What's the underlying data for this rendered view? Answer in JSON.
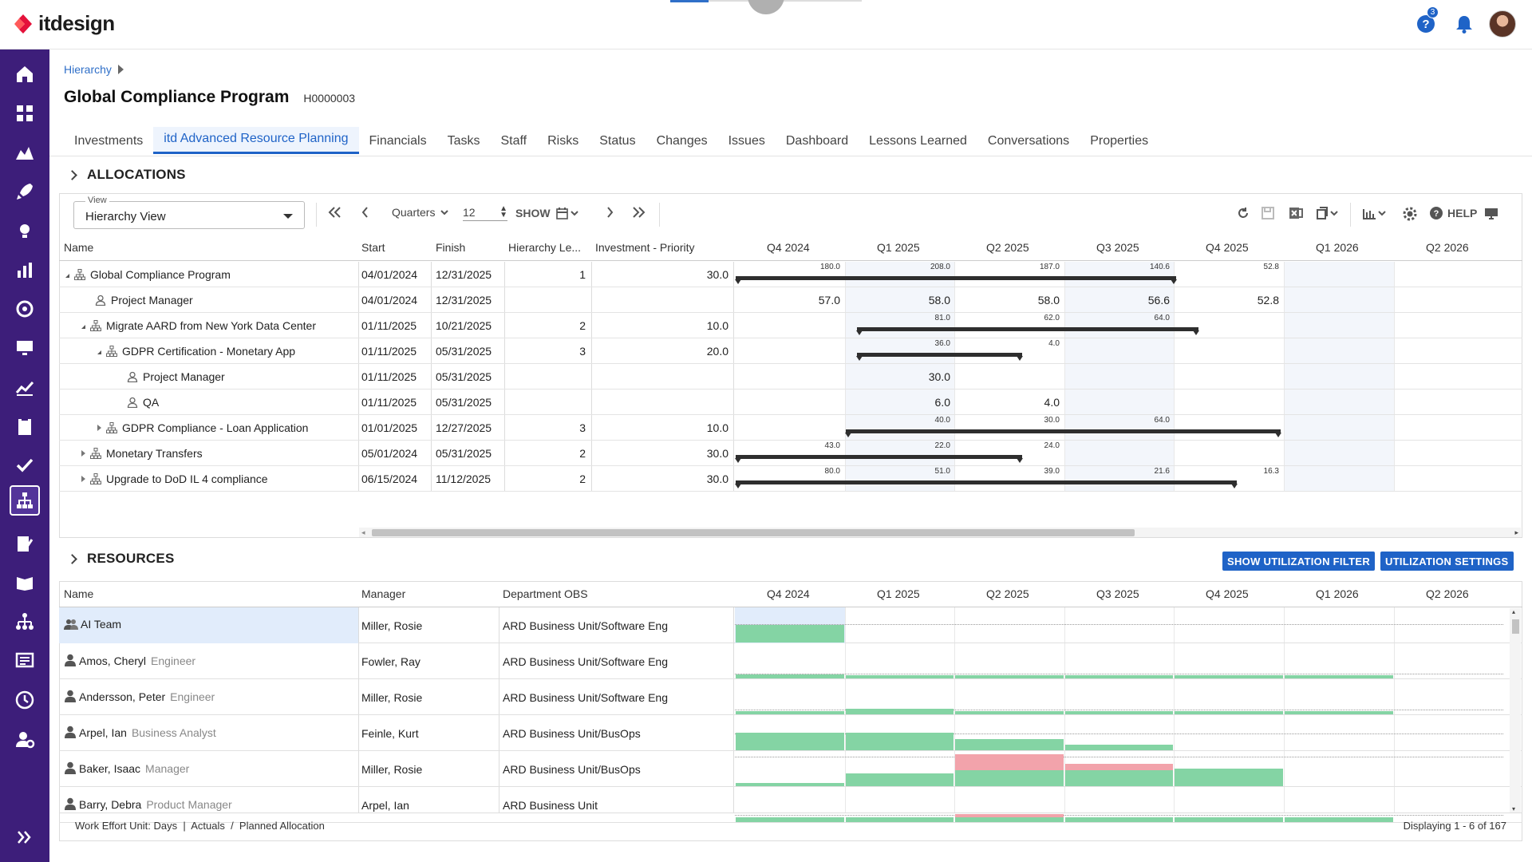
{
  "app": {
    "name": "itdesign",
    "help_badge": "3"
  },
  "breadcrumb": {
    "label": "Hierarchy"
  },
  "page": {
    "title": "Global Compliance Program",
    "code": "H0000003"
  },
  "tabs": [
    "Investments",
    "itd Advanced Resource Planning",
    "Financials",
    "Tasks",
    "Staff",
    "Risks",
    "Status",
    "Changes",
    "Issues",
    "Dashboard",
    "Lessons Learned",
    "Conversations",
    "Properties"
  ],
  "active_tab": "itd Advanced Resource Planning",
  "nav_icons": [
    "home-icon",
    "dashboard-icon",
    "portfolio-icon",
    "rocket-icon",
    "ideas-icon",
    "reports-icon",
    "goals-icon",
    "monitor-icon",
    "trend-icon",
    "clipboard-icon",
    "check-icon",
    "hierarchy-icon",
    "timesheet-icon",
    "book-icon",
    "org-chart-icon",
    "list-icon",
    "clock-icon",
    "admin-icon",
    "expand-icon"
  ],
  "allocations": {
    "title": "ALLOCATIONS",
    "view_label": "View",
    "view_value": "Hierarchy View",
    "period": "Quarters",
    "count": "12",
    "show_label": "SHOW",
    "help_label": "HELP",
    "columns": {
      "name": "Name",
      "start": "Start",
      "finish": "Finish",
      "level": "Hierarchy Le...",
      "priority": "Investment - Priority"
    },
    "quarters": [
      "Q4 2024",
      "Q1 2025",
      "Q2 2025",
      "Q3 2025",
      "Q4 2025",
      "Q1 2026",
      "Q2 2026"
    ],
    "rows": [
      {
        "name": "Global Compliance Program",
        "type": "hier",
        "indent": 0,
        "tree": "open",
        "start": "04/01/2024",
        "finish": "12/31/2025",
        "level": "1",
        "priority": "30.0",
        "small": [
          "180.0",
          "208.0",
          "187.0",
          "140.6",
          "52.8"
        ],
        "big": []
      },
      {
        "name": "Project Manager",
        "type": "role",
        "indent": 1,
        "tree": "",
        "start": "04/01/2024",
        "finish": "12/31/2025",
        "level": "",
        "priority": "",
        "small": [],
        "big": [
          "57.0",
          "58.0",
          "58.0",
          "56.6",
          "52.8"
        ]
      },
      {
        "name": "Migrate AARD from New York Data Center",
        "type": "hier",
        "indent": 1,
        "tree": "open",
        "start": "01/11/2025",
        "finish": "10/21/2025",
        "level": "2",
        "priority": "10.0",
        "small": [
          "",
          "81.0",
          "62.0",
          "64.0",
          ""
        ],
        "big": []
      },
      {
        "name": "GDPR Certification - Monetary App",
        "type": "hier",
        "indent": 2,
        "tree": "open",
        "start": "01/11/2025",
        "finish": "05/31/2025",
        "level": "3",
        "priority": "20.0",
        "small": [
          "",
          "36.0",
          "4.0",
          "",
          ""
        ],
        "big": []
      },
      {
        "name": "Project Manager",
        "type": "role",
        "indent": 3,
        "tree": "",
        "start": "01/11/2025",
        "finish": "05/31/2025",
        "level": "",
        "priority": "",
        "small": [],
        "big": [
          "",
          "30.0",
          "",
          "",
          ""
        ]
      },
      {
        "name": "QA",
        "type": "role",
        "indent": 3,
        "tree": "",
        "start": "01/11/2025",
        "finish": "05/31/2025",
        "level": "",
        "priority": "",
        "small": [],
        "big": [
          "",
          "6.0",
          "4.0",
          "",
          ""
        ]
      },
      {
        "name": "GDPR Compliance - Loan Application",
        "type": "hier",
        "indent": 2,
        "tree": "closed",
        "start": "01/01/2025",
        "finish": "12/27/2025",
        "level": "3",
        "priority": "10.0",
        "small": [
          "",
          "40.0",
          "30.0",
          "64.0",
          ""
        ],
        "big": []
      },
      {
        "name": "Monetary Transfers",
        "type": "hier",
        "indent": 1,
        "tree": "closed",
        "start": "05/01/2024",
        "finish": "05/31/2025",
        "level": "2",
        "priority": "30.0",
        "small": [
          "43.0",
          "22.0",
          "24.0",
          "",
          ""
        ],
        "big": []
      },
      {
        "name": "Upgrade to DoD IL 4 compliance",
        "type": "hier",
        "indent": 1,
        "tree": "closed",
        "start": "06/15/2024",
        "finish": "11/12/2025",
        "level": "2",
        "priority": "30.0",
        "small": [
          "80.0",
          "51.0",
          "39.0",
          "21.6",
          "16.3"
        ],
        "big": []
      }
    ]
  },
  "resources": {
    "title": "RESOURCES",
    "btn_filter": "SHOW UTILIZATION FILTER",
    "btn_settings": "UTILIZATION SETTINGS",
    "columns": {
      "name": "Name",
      "manager": "Manager",
      "dept": "Department OBS"
    },
    "quarters": [
      "Q4 2024",
      "Q1 2025",
      "Q2 2025",
      "Q3 2025",
      "Q4 2025",
      "Q1 2026",
      "Q2 2026"
    ],
    "rows": [
      {
        "name": "AI Team",
        "role": "",
        "team": true,
        "manager": "Miller, Rosie",
        "dept": "ARD Business Unit/Software Eng"
      },
      {
        "name": "Amos, Cheryl",
        "role": "Engineer",
        "team": false,
        "manager": "Fowler, Ray",
        "dept": "ARD Business Unit/Software Eng"
      },
      {
        "name": "Andersson, Peter",
        "role": "Engineer",
        "team": false,
        "manager": "Miller, Rosie",
        "dept": "ARD Business Unit/Software Eng"
      },
      {
        "name": "Arpel, Ian",
        "role": "Business Analyst",
        "team": false,
        "manager": "Feinle, Kurt",
        "dept": "ARD Business Unit/BusOps"
      },
      {
        "name": "Baker, Isaac",
        "role": "Manager",
        "team": false,
        "manager": "Miller, Rosie",
        "dept": "ARD Business Unit/BusOps"
      },
      {
        "name": "Barry, Debra",
        "role": "Product Manager",
        "team": false,
        "manager": "Arpel, Ian",
        "dept": "ARD Business Unit"
      }
    ],
    "footer_left": "Work Effort Unit: Days  |  Actuals  /  Planned Allocation",
    "footer_right": "Displaying 1 - 6 of 167"
  },
  "colors": {
    "nav": "#3d1e7a",
    "accent": "#1f63c7",
    "util_green": "#84d4a4",
    "util_red": "#f2a3ab"
  }
}
